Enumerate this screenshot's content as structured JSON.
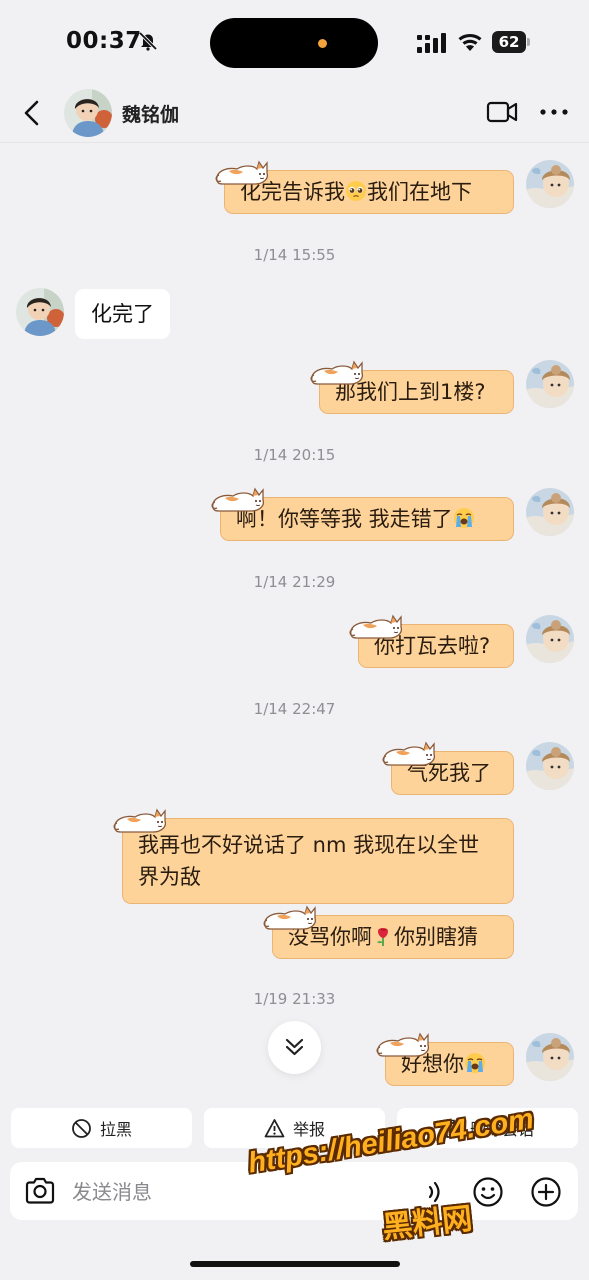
{
  "status_bar": {
    "time": "00:37",
    "battery": "62"
  },
  "header": {
    "contact_name": "魏铭伽"
  },
  "messages": [
    {
      "side": "out",
      "parts": [
        "化完告诉我",
        "我们在地下"
      ],
      "emoji": "pleading-face-emoji"
    },
    {
      "side": "time",
      "text": "1/14 15:55"
    },
    {
      "side": "in",
      "text": "化完了"
    },
    {
      "side": "out",
      "text": "那我们上到1楼?"
    },
    {
      "side": "time",
      "text": "1/14 20:15"
    },
    {
      "side": "out",
      "parts": [
        "啊！你等等我 我走错了",
        ""
      ],
      "emoji": "loudly-crying-face-emoji"
    },
    {
      "side": "time",
      "text": "1/14 21:29"
    },
    {
      "side": "out",
      "text": "你打瓦去啦?"
    },
    {
      "side": "time",
      "text": "1/14 22:47"
    },
    {
      "side": "out",
      "text": "气死我了"
    },
    {
      "side": "out",
      "text": "我再也不好说话了 nm 我现在以全世界为敌"
    },
    {
      "side": "out",
      "parts": [
        "没骂你啊",
        "你别瞎猜"
      ],
      "emoji": "rose-emoji"
    },
    {
      "side": "time",
      "text": "1/19 21:33"
    },
    {
      "side": "out",
      "parts": [
        "好想你",
        ""
      ],
      "emoji": "loudly-crying-face-emoji"
    }
  ],
  "actions": {
    "block": "拉黑",
    "report": "举报",
    "delete": "删除会话"
  },
  "composer": {
    "placeholder": "发送消息"
  },
  "watermark": {
    "url": "https://heiliao74.com",
    "site": "黑料网"
  },
  "colors": {
    "bubble_out": "#fdd39a",
    "bubble_border": "#ecb473",
    "background": "#f1f1f3"
  }
}
